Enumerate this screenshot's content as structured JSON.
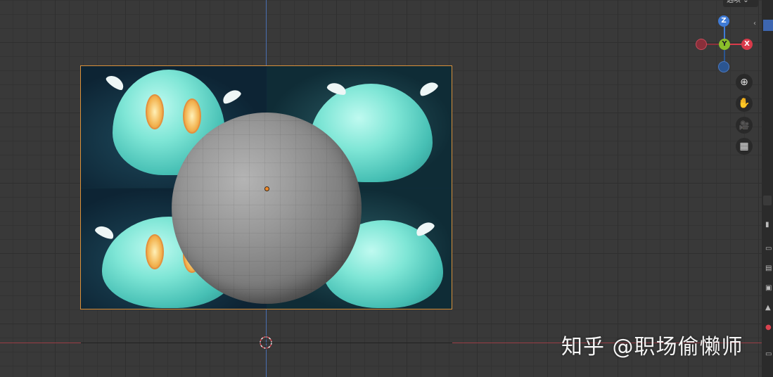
{
  "header": {
    "options_label": "选项",
    "options_chevron": "chevron-down-icon"
  },
  "gizmo": {
    "z_label": "Z",
    "y_label": "Y",
    "x_label": "X"
  },
  "viewport_tools": [
    {
      "name": "zoom-icon",
      "glyph": "⊕"
    },
    {
      "name": "hand-pan-icon",
      "glyph": "✋"
    },
    {
      "name": "camera-icon",
      "glyph": "🎥"
    },
    {
      "name": "grid-icon",
      "glyph": "▦"
    }
  ],
  "sidebar": {
    "toggle_glyph": "‹"
  },
  "watermark": {
    "text": "知乎 @职场偷懒师"
  },
  "colors": {
    "x_axis": "#d93a4a",
    "y_axis": "#8bbf2a",
    "z_axis": "#3f7bd6",
    "selection_outline": "#d9903a",
    "origin": "#f18a2a"
  }
}
